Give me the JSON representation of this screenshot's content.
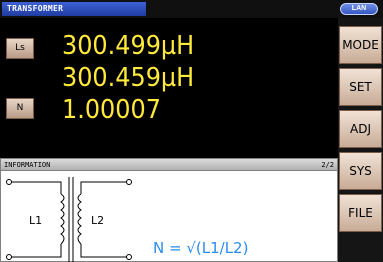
{
  "header": {
    "mode_title": "TRANSFORMER",
    "interface_badge": "LAN"
  },
  "measurements": [
    {
      "param_label": "Ls",
      "value": "300.499µH"
    },
    {
      "param_label": "",
      "value": "300.459µH"
    },
    {
      "param_label": "N",
      "value": "1.00007"
    }
  ],
  "sidebar": {
    "buttons": [
      "MODE",
      "SET",
      "ADJ",
      "SYS",
      "FILE"
    ]
  },
  "info": {
    "title": "INFORMATION",
    "page": "2/2",
    "coil_1": "L1",
    "coil_2": "L2",
    "formula": "N = √(L1/L2)"
  },
  "colors": {
    "measurement_text": "#ffe93a",
    "formula_text": "#2a8cf0",
    "title_tab": "#2b4bc0"
  }
}
